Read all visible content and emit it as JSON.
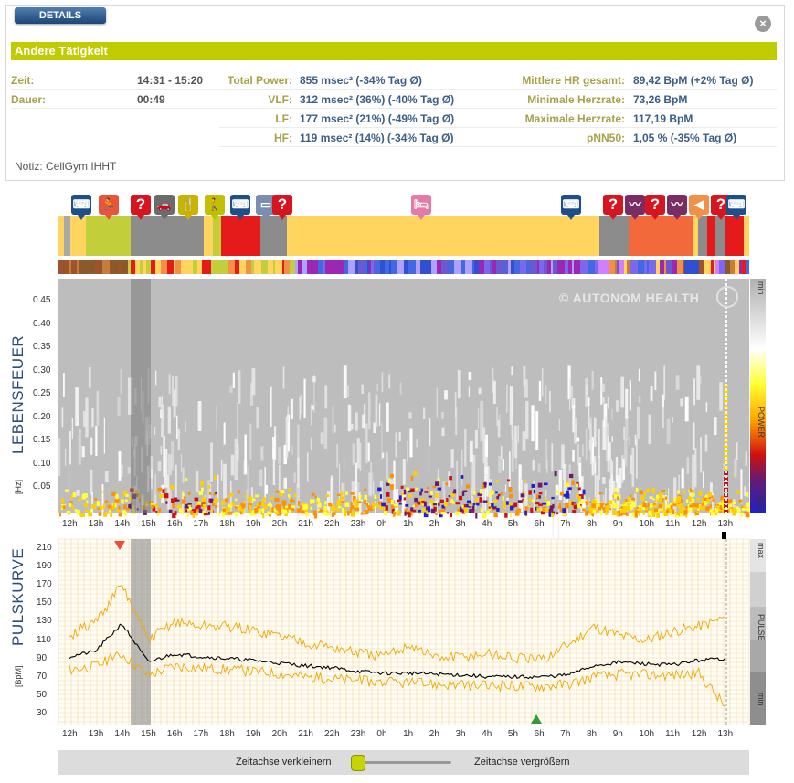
{
  "details": {
    "tab_label": "DETAILS",
    "title": "Andere Tätigkeit",
    "zeit_label": "Zeit:",
    "zeit_value": "14:31 - 15:20",
    "dauer_label": "Dauer:",
    "dauer_value": "00:49",
    "power_rows": [
      {
        "label": "Total Power:",
        "value": "855 msec² (-34% Tag Ø)"
      },
      {
        "label": "VLF:",
        "value": "312 msec² (36%) (-40% Tag Ø)"
      },
      {
        "label": "LF:",
        "value": "177 msec² (21%) (-49% Tag Ø)"
      },
      {
        "label": "HF:",
        "value": "119 msec² (14%) (-34% Tag Ø)"
      }
    ],
    "hr_rows": [
      {
        "label": "Mittlere HR gesamt:",
        "value": "89,42 BpM (+2% Tag Ø)"
      },
      {
        "label": "Minimale Herzrate:",
        "value": "73,26 BpM"
      },
      {
        "label": "Maximale Herzrate:",
        "value": "117,19 BpM"
      },
      {
        "label": "pNN50:",
        "value": "1,05 % (-35% Tag Ø)"
      }
    ],
    "note": "Notiz: CellGym IHHT"
  },
  "icons": [
    {
      "name": "keyboard-icon",
      "glyph": "⌨",
      "color": "#1f4f8b"
    },
    {
      "name": "sport-icon",
      "glyph": "🏃",
      "color": "#e8553a"
    },
    {
      "name": "question-icon",
      "glyph": "?",
      "color": "#d8141e"
    },
    {
      "name": "car-icon",
      "glyph": "🚗",
      "color": "#6b6b6b"
    },
    {
      "name": "food-icon",
      "glyph": "🍴",
      "color": "#c7b300"
    },
    {
      "name": "walk-icon",
      "glyph": "🚶",
      "color": "#c0c000"
    },
    {
      "name": "keyboard-icon",
      "glyph": "⌨",
      "color": "#1f4f8b"
    },
    {
      "name": "screen-icon",
      "glyph": "▭",
      "color": "#7a8fb0"
    },
    {
      "name": "question-icon",
      "glyph": "?",
      "color": "#d8141e"
    },
    {
      "name": "bed-icon",
      "glyph": "🛏",
      "color": "#e57aa8"
    },
    {
      "name": "keyboard-icon",
      "glyph": "⌨",
      "color": "#1f4f8b"
    },
    {
      "name": "question-icon",
      "glyph": "?",
      "color": "#d8141e"
    },
    {
      "name": "relax-icon",
      "glyph": "〰",
      "color": "#7b2d63"
    },
    {
      "name": "question-icon",
      "glyph": "?",
      "color": "#d8141e"
    },
    {
      "name": "relax-icon",
      "glyph": "〰",
      "color": "#7b2d63"
    },
    {
      "name": "speaker-icon",
      "glyph": "◀",
      "color": "#f29048"
    },
    {
      "name": "question-icon",
      "glyph": "?",
      "color": "#d8141e"
    },
    {
      "name": "keyboard-icon",
      "glyph": "⌨",
      "color": "#1f4f8b"
    }
  ],
  "lebensfeuer": {
    "title": "LEBENSFEUER",
    "unit": "[Hz]",
    "y_ticks": [
      "0.45",
      "0.40",
      "0.35",
      "0.30",
      "0.25",
      "0.20",
      "0.15",
      "0.10",
      "0.05"
    ],
    "watermark": "© AUTONOM HEALTH",
    "scale_min": "min",
    "scale_label": "POWER",
    "scale_max": "max"
  },
  "pulskurve": {
    "title": "PULSKURVE",
    "unit": "[BpM]",
    "y_ticks": [
      "210",
      "190",
      "170",
      "150",
      "130",
      "110",
      "90",
      "70",
      "50",
      "30"
    ],
    "scale_max": "max",
    "scale_label": "PULSE",
    "scale_min": "min"
  },
  "time_ticks": [
    "12h",
    "13h",
    "14h",
    "15h",
    "16h",
    "17h",
    "18h",
    "19h",
    "20h",
    "21h",
    "22h",
    "23h",
    "0h",
    "1h",
    "2h",
    "3h",
    "4h",
    "5h",
    "6h",
    "7h",
    "8h",
    "9h",
    "10h",
    "11h",
    "12h",
    "13h"
  ],
  "chart_data": {
    "type": "line",
    "x": [
      "12h",
      "13h",
      "14h",
      "15h",
      "16h",
      "17h",
      "18h",
      "19h",
      "20h",
      "21h",
      "22h",
      "23h",
      "0h",
      "1h",
      "2h",
      "3h",
      "4h",
      "5h",
      "6h",
      "7h",
      "8h",
      "9h",
      "10h",
      "11h",
      "12h",
      "13h"
    ],
    "series": [
      {
        "values": [
          92,
          98,
          128,
          86,
          95,
          92,
          90,
          88,
          85,
          82,
          80,
          76,
          74,
          74,
          73,
          72,
          70,
          70,
          70,
          72,
          82,
          86,
          84,
          83,
          88,
          90
        ]
      },
      {
        "values": [
          115,
          130,
          170,
          110,
          130,
          125,
          125,
          120,
          115,
          108,
          102,
          96,
          92,
          105,
          90,
          92,
          95,
          90,
          88,
          105,
          125,
          115,
          110,
          120,
          125,
          135
        ]
      },
      {
        "values": [
          78,
          82,
          95,
          72,
          82,
          80,
          78,
          76,
          74,
          70,
          68,
          66,
          64,
          63,
          62,
          61,
          60,
          60,
          60,
          62,
          70,
          73,
          72,
          72,
          74,
          38
        ]
      }
    ],
    "ylim": [
      20,
      220
    ],
    "ylabel": "[BpM]"
  },
  "slider": {
    "left_label": "Zeitachse verkleinern",
    "right_label": "Zeitachse vergrößern"
  }
}
